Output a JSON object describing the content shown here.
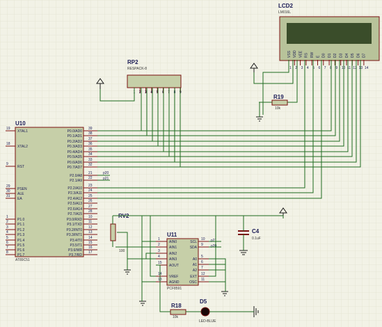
{
  "colors": {
    "background": "#f2f2e6",
    "grid": "#dcdcc8",
    "wire": "#1f6b1f",
    "pin": "#7a1010",
    "chip_fill": "#c6cfa8",
    "lcd_screen": "#3a4d2a",
    "label": "#1a1a55"
  },
  "lcd": {
    "ref": "LCD2",
    "part": "LM016L",
    "pins": [
      "VSS",
      "VDD",
      "VEE",
      "RS",
      "RW",
      "E",
      "D0",
      "D1",
      "D2",
      "D3",
      "D4",
      "D5",
      "D6",
      "D7"
    ],
    "pin_numbers": [
      "1",
      "2",
      "3",
      "4",
      "5",
      "6",
      "7",
      "8",
      "9",
      "10",
      "11",
      "12",
      "13",
      "14"
    ]
  },
  "rp2": {
    "ref": "RP2",
    "part": "RESPACK-8",
    "pins": [
      "1",
      "2",
      "3",
      "4",
      "5",
      "6",
      "7",
      "8",
      "9"
    ]
  },
  "r19": {
    "ref": "R19",
    "value": "10k"
  },
  "u10": {
    "ref": "U10",
    "part": "AT89C51",
    "left_pins": [
      {
        "num": "19",
        "name": "XTAL1"
      },
      {
        "num": "18",
        "name": "XTAL2"
      },
      {
        "num": "9",
        "name": "RST"
      },
      {
        "num": "29",
        "name": "PSEN"
      },
      {
        "num": "30",
        "name": "ALE"
      },
      {
        "num": "31",
        "name": "EA"
      },
      {
        "num": "1",
        "name": "P1.0"
      },
      {
        "num": "2",
        "name": "P1.1"
      },
      {
        "num": "3",
        "name": "P1.2"
      },
      {
        "num": "4",
        "name": "P1.3"
      },
      {
        "num": "5",
        "name": "P1.4"
      },
      {
        "num": "6",
        "name": "P1.5"
      },
      {
        "num": "7",
        "name": "P1.6"
      },
      {
        "num": "8",
        "name": "P1.7"
      }
    ],
    "right_pins": [
      {
        "num": "39",
        "name": "P0.0/AD0"
      },
      {
        "num": "38",
        "name": "P0.1/AD1"
      },
      {
        "num": "37",
        "name": "P0.2/AD2"
      },
      {
        "num": "36",
        "name": "P0.3/AD3"
      },
      {
        "num": "35",
        "name": "P0.4/AD4"
      },
      {
        "num": "34",
        "name": "P0.5/AD5"
      },
      {
        "num": "33",
        "name": "P0.6/AD6"
      },
      {
        "num": "32",
        "name": "P0.7/AD7"
      },
      {
        "num": "21",
        "name": "P2.0/A8"
      },
      {
        "num": "22",
        "name": "P2.1/A9"
      },
      {
        "num": "23",
        "name": "P2.2/A10"
      },
      {
        "num": "24",
        "name": "P2.3/A11"
      },
      {
        "num": "25",
        "name": "P2.4/A12"
      },
      {
        "num": "26",
        "name": "P2.5/A13"
      },
      {
        "num": "27",
        "name": "P2.6/A14"
      },
      {
        "num": "28",
        "name": "P2.7/A15"
      },
      {
        "num": "10",
        "name": "P3.0/RXD"
      },
      {
        "num": "11",
        "name": "P3.1/TXD"
      },
      {
        "num": "12",
        "name": "P3.2/INT0"
      },
      {
        "num": "13",
        "name": "P3.3/INT1"
      },
      {
        "num": "14",
        "name": "P3.4/T0"
      },
      {
        "num": "15",
        "name": "P3.5/T1"
      },
      {
        "num": "16",
        "name": "P3.6/WR"
      },
      {
        "num": "17",
        "name": "P3.7/RD"
      }
    ],
    "net_labels": [
      "p20",
      "p21"
    ]
  },
  "rv2": {
    "ref": "RV2",
    "value": "100"
  },
  "c4": {
    "ref": "C4",
    "value": "0.1uF"
  },
  "u11": {
    "ref": "U11",
    "part": "PCF8591",
    "left_pins": [
      {
        "num": "1",
        "name": "AIN0"
      },
      {
        "num": "2",
        "name": "AIN1"
      },
      {
        "num": "3",
        "name": "AIN2"
      },
      {
        "num": "4",
        "name": "AIN3"
      },
      {
        "num": "15",
        "name": "AOUT"
      },
      {
        "num": "14",
        "name": "VREF"
      },
      {
        "num": "13",
        "name": "AGND"
      }
    ],
    "right_pins": [
      {
        "num": "10",
        "name": "SCL"
      },
      {
        "num": "9",
        "name": "SDA"
      },
      {
        "num": "5",
        "name": "A0"
      },
      {
        "num": "6",
        "name": "A1"
      },
      {
        "num": "7",
        "name": "A2"
      },
      {
        "num": "12",
        "name": "EXT"
      },
      {
        "num": "11",
        "name": "OSC"
      }
    ],
    "net_labels": [
      "p21",
      "p20"
    ]
  },
  "r18": {
    "ref": "R18",
    "value": "10k"
  },
  "d5": {
    "ref": "D5",
    "part": "LED-BLUE"
  }
}
